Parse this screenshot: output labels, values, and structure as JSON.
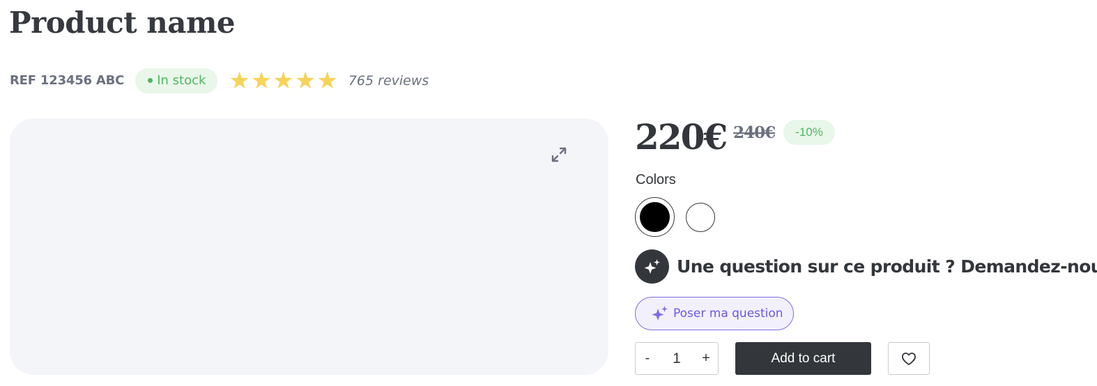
{
  "product": {
    "name": "Product name",
    "ref": "REF 123456 ABC",
    "stock_status": "In stock",
    "rating_stars": 5,
    "reviews": "765 reviews"
  },
  "media": {
    "expand_icon": "expand-icon"
  },
  "pricing": {
    "price": "220€",
    "old_price": "240€",
    "discount": "-10%"
  },
  "colors": {
    "label": "Colors",
    "options": [
      {
        "name": "black",
        "hex": "#000000",
        "selected": true
      },
      {
        "name": "white",
        "hex": "#ffffff",
        "selected": false
      }
    ]
  },
  "question": {
    "heading": "Une question sur ce produit ? Demandez-nous !",
    "button_label": "Poser ma question",
    "icon": "sparkle-icon"
  },
  "cart": {
    "decrement_label": "-",
    "quantity": "1",
    "increment_label": "+",
    "add_label": "Add to cart",
    "wishlist_icon": "heart-icon"
  },
  "theme": {
    "dark": "#33363b",
    "success": "#4fb760",
    "accent": "#7d6ee4",
    "star": "#f7d358"
  }
}
